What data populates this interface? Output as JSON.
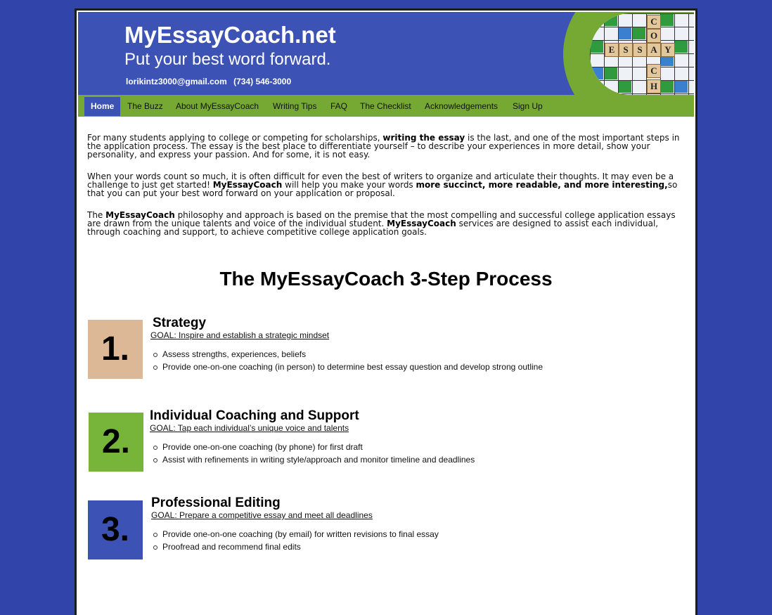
{
  "header": {
    "site_title": "MyEssayCoach.net",
    "tagline": "Put your best word forward.",
    "email": "lorikintz3000@gmail.com",
    "phone": "(734) 546-3000",
    "tiles": [
      "C",
      "O",
      "E",
      "S",
      "S",
      "A",
      "Y",
      "C",
      "H"
    ]
  },
  "nav": {
    "items": [
      {
        "label": "Home",
        "active": true
      },
      {
        "label": "The Buzz"
      },
      {
        "label": "About MyEssayCoach"
      },
      {
        "label": "Writing Tips"
      },
      {
        "label": "FAQ"
      },
      {
        "label": "The Checklist"
      },
      {
        "label": "Acknowledgements"
      },
      {
        "label": "Sign Up"
      }
    ]
  },
  "intro": {
    "p1_a": "For many students applying to college or competing for scholarships, ",
    "p1_b": "writing the essay",
    "p1_c": " is the last, and one of the most important steps in the application process. The essay is the best place to differentiate yourself – to describe your experiences in more detail, show your personality, and express your passion. And for some, it is not easy.",
    "p2_a": "When your words count so much, it is often difficult for even the best of writers to organize and articulate their thoughts. It may even be a challenge to just get started! ",
    "p2_b": "MyEssayCoach",
    "p2_c": " will help you make your words ",
    "p2_d": "more succinct, more readable, and more interesting,",
    "p2_e": "so that you can put your best word forward on your application or proposal.",
    "p3_a": "The ",
    "p3_b": "MyEssayCoach",
    "p3_c": " philosophy and approach is based on the premise that the most compelling and successful college application essays are drawn from the unique talents and voice of the individual student. ",
    "p3_d": "MyEssayCoach",
    "p3_e": " services are designed to assist each individual, through coaching and support, to achieve competitive college application goals."
  },
  "process_heading": "The MyEssayCoach 3-Step Process",
  "steps": [
    {
      "number": "1.",
      "color": "#dcb896",
      "title": "Strategy",
      "goal": "GOAL:  Inspire and establish a strategic mindset",
      "bullets": [
        "Assess strengths, experiences, beliefs",
        "Provide one-on-one coaching (in person) to determine best essay question and develop strong outline"
      ]
    },
    {
      "number": "2.",
      "color": "#76b43a",
      "title": "Individual Coaching and Support",
      "goal": "GOAL:  Tap each individual’s unique voice and talents",
      "bullets": [
        "Provide one-on-one coaching (by phone) for first draft",
        "Assist with refinements in writing style/approach and monitor timeline and deadlines"
      ]
    },
    {
      "number": "3.",
      "color": "#3d52b5",
      "title": "Professional Editing",
      "goal": "GOAL:  Prepare a competitive essay and meet all deadlines",
      "bullets": [
        "Provide one-on-one coaching (by email) for written revisions to final essay",
        "Proofread and recommend final edits"
      ]
    }
  ]
}
